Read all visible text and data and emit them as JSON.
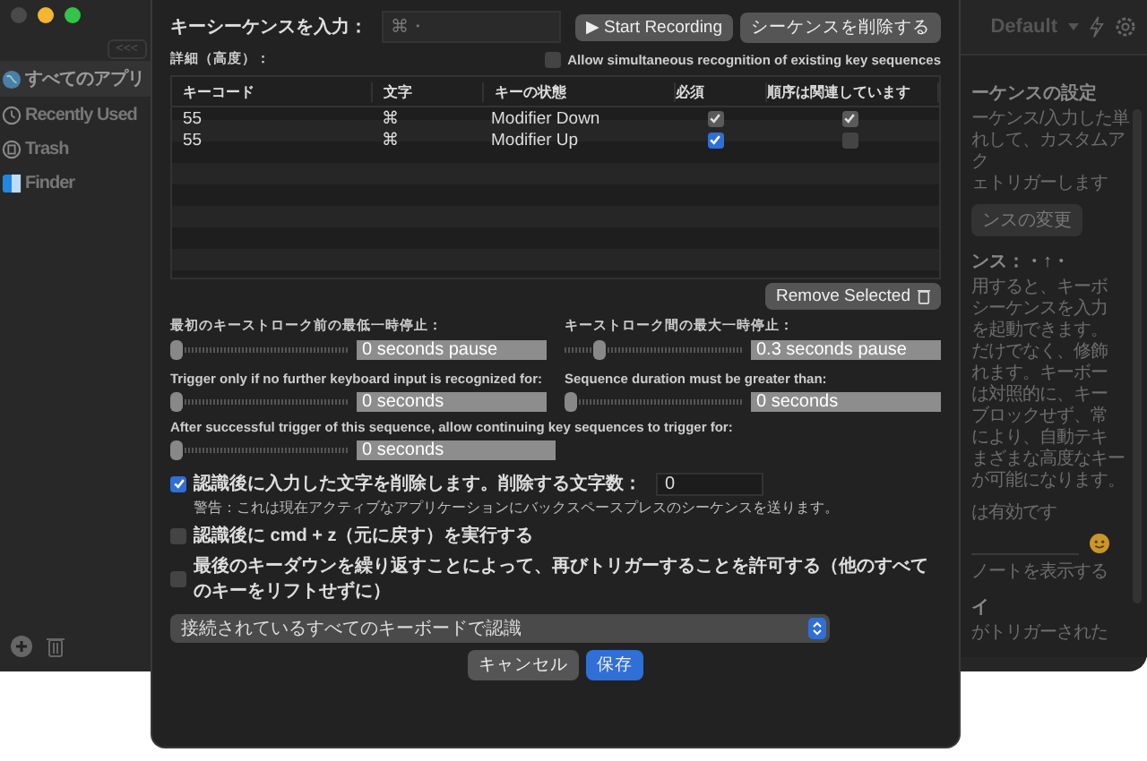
{
  "sidebar": {
    "collapse_button": "<<<",
    "items": [
      {
        "label": "すべてのアプリ",
        "selected": true
      },
      {
        "label": "Recently Used",
        "selected": false
      },
      {
        "label": "Trash",
        "selected": false
      },
      {
        "label": "Finder",
        "selected": false
      }
    ]
  },
  "right_panel": {
    "profile": "Default",
    "title": "ーケンスの設定",
    "description": [
      "ーケンス/入力した単",
      "れして、カスタムアク",
      "ェトリガーします"
    ],
    "change_button": "ンスの変更",
    "sequence": "ンス：・↑・",
    "help": [
      "用すると、キーボ",
      "シーケンスを入力",
      "を起動できます。",
      "だけでなく、修飾",
      "れます。キーボー",
      "は対照的に、キー",
      "ブロックせず、常",
      "により、自動テキ",
      "まざまな高度なキー",
      "が可能になります。"
    ],
    "status": "は有効です",
    "show_note": "ノートを表示する",
    "section": "イ",
    "trigger_note": "がトリガーされた"
  },
  "sheet": {
    "sequence_label": "キーシーケンスを入力：",
    "sequence_value": "⌘・",
    "record_button": "▶ Start Recording",
    "delete_button": "シーケンスを削除する",
    "advanced_label": "詳細（高度）：",
    "allow_simultaneous": {
      "label": "Allow simultaneous recognition of existing key sequences",
      "checked": false
    },
    "table": {
      "columns": [
        "キーコード",
        "文字",
        "キーの状態",
        "必須",
        "順序は関連しています"
      ],
      "rows": [
        {
          "keycode": "55",
          "char": "⌘",
          "state": "Modifier Down",
          "required": {
            "checked": true,
            "disabled": true
          },
          "ordered": {
            "checked": true,
            "disabled": true
          }
        },
        {
          "keycode": "55",
          "char": "⌘",
          "state": "Modifier Up",
          "required": {
            "checked": true,
            "disabled": false
          },
          "ordered": {
            "checked": false,
            "disabled": false
          }
        }
      ]
    },
    "remove_button": "Remove Selected",
    "sliders": [
      {
        "label": "最初のキーストローク前の最低一時停止：",
        "level": 0,
        "value": "0 seconds pause"
      },
      {
        "label": "キーストローク間の最大一時停止：",
        "level": 0.17,
        "value": "0.3 seconds pause"
      },
      {
        "label": "Trigger only if no further keyboard input is recognized for:",
        "level": 0,
        "value": "0 seconds"
      },
      {
        "label": "Sequence duration must be greater than:",
        "level": 0,
        "value": "0 seconds"
      },
      {
        "label": "After successful trigger of this sequence, allow continuing key sequences to trigger for:",
        "level": 0,
        "value": "0 seconds"
      }
    ],
    "delete_typed": {
      "label": "認識後に入力した文字を削除します。削除する文字数：",
      "checked": true,
      "count": "0",
      "warning": "警告：これは現在アクティブなアプリケーションにバックスペースプレスのシーケンスを送ります。"
    },
    "undo": {
      "label": "認識後に cmd + z（元に戻す）を実行する",
      "checked": false
    },
    "repeat": {
      "label": "最後のキーダウンを繰り返すことによって、再びトリガーすることを許可する（他のすべてのキーをリフトせずに）",
      "checked": false
    },
    "keyboard_select": "接続されているすべてのキーボードで認識",
    "buttons": [
      {
        "label": "キャンセル",
        "primary": false
      },
      {
        "label": "保存",
        "primary": true
      }
    ]
  }
}
